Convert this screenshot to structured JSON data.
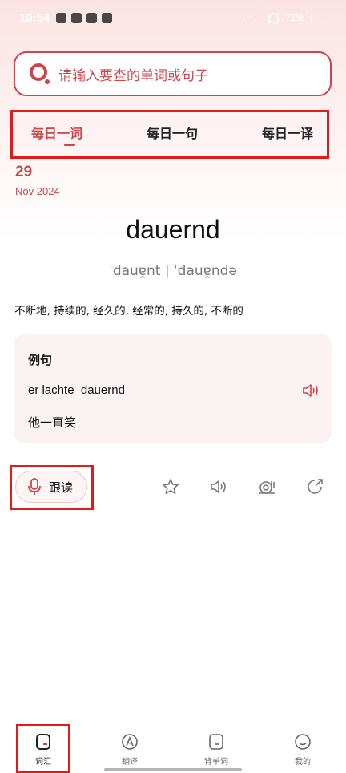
{
  "status_bar": {
    "time": "10:54",
    "battery": "71%"
  },
  "search": {
    "placeholder": "请输入要查的单词或句子"
  },
  "tabs": [
    {
      "label": "每日一词",
      "active": true
    },
    {
      "label": "每日一句",
      "active": false
    },
    {
      "label": "每日一译",
      "active": false
    }
  ],
  "date": {
    "day": "29",
    "month_year": "Nov 2024"
  },
  "word": {
    "headword": "dauernd",
    "phonetic": "ˈdauɐ̯nt | ˈdauɐ̯ndə",
    "definition": "不断地, 持续的, 经久的, 经常的, 持久的, 不断的"
  },
  "example": {
    "title": "例句",
    "sentence": "er lachte  dauernd",
    "translation": "他一直笑"
  },
  "actions": {
    "follow_read_label": "跟读",
    "icons": [
      "star-icon",
      "speaker-icon",
      "snail-icon",
      "share-icon"
    ]
  },
  "bottom_nav": [
    {
      "label": "词汇",
      "icon": "vocab-icon",
      "active": true
    },
    {
      "label": "翻译",
      "icon": "translate-icon",
      "active": false
    },
    {
      "label": "背单词",
      "icon": "memorize-icon",
      "active": false
    },
    {
      "label": "我的",
      "icon": "profile-icon",
      "active": false
    }
  ],
  "colors": {
    "accent": "#c8474a",
    "highlight_frame": "#e11a1a",
    "card_bg": "#fbf3f3"
  }
}
